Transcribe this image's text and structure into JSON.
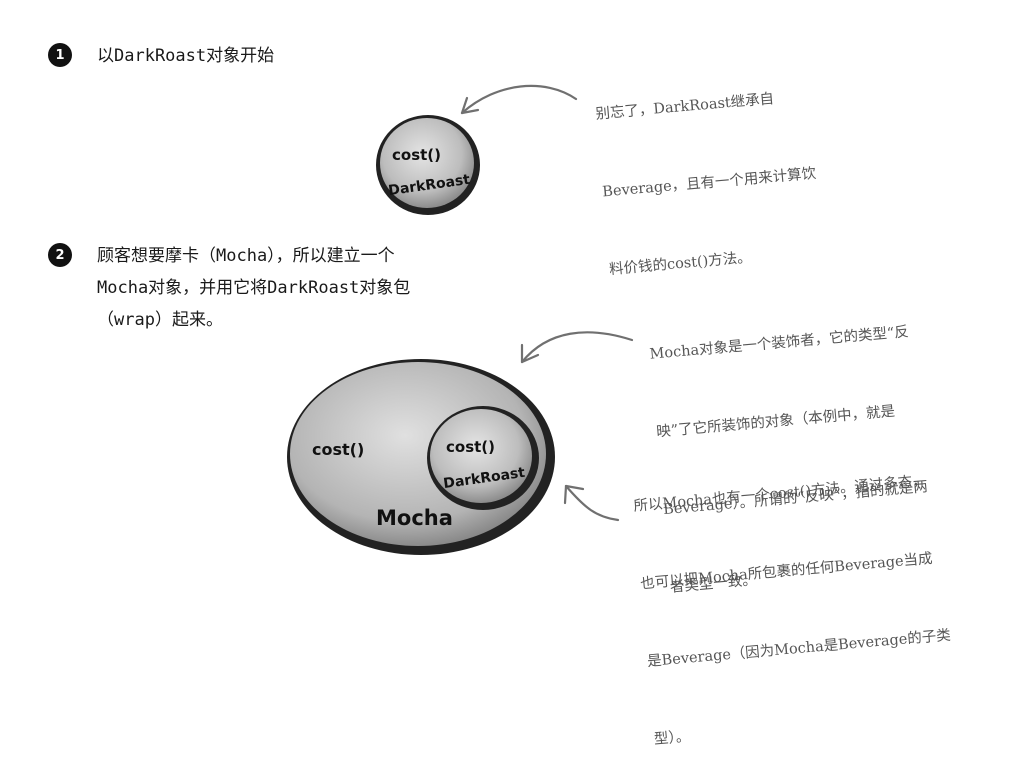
{
  "step1": {
    "number": "1",
    "text": "以DarkRoast对象开始"
  },
  "step2": {
    "number": "2",
    "lines": [
      "顾客想要摩卡（Mocha），所以建立一个",
      "Mocha对象，并用它将DarkRoast对象包",
      "（wrap）起来。"
    ]
  },
  "note1": {
    "lines": [
      "别忘了，DarkRoast继承自",
      "Beverage，且有一个用来计算饮",
      "料价钱的cost()方法。"
    ]
  },
  "note2": {
    "lines": [
      "Mocha对象是一个装饰者，它的类型“反",
      "映”了它所装饰的对象（本例中，就是",
      "Beverage）。所谓的“反映”，指的就是两",
      "者类型一致。"
    ]
  },
  "note3": {
    "lines": [
      "所以Mocha也有一个cost()方法。通过多态，",
      "也可以把Mocha所包裹的任何Beverage当成",
      "是Beverage（因为Mocha是Beverage的子类",
      "型）。"
    ]
  },
  "diagram1": {
    "method": "cost()",
    "name": "DarkRoast"
  },
  "diagram2": {
    "outer_method": "cost()",
    "outer_name": "Mocha",
    "inner_method": "cost()",
    "inner_name": "DarkRoast"
  }
}
